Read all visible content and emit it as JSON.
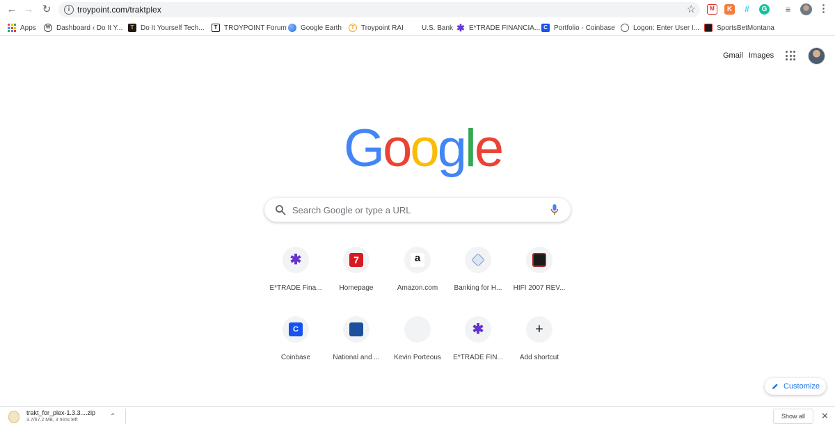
{
  "colors": {
    "google_blue": "#4285F4",
    "google_red": "#EA4335",
    "google_yellow": "#FBBC05",
    "google_green": "#34A853",
    "accent": "#1A73E8"
  },
  "toolbar": {
    "back_icon": "arrow-left-icon",
    "forward_icon": "arrow-right-icon",
    "reload_icon": "reload-icon",
    "url": "troypoint.com/traktplex",
    "bookmark_star_icon": "star-icon",
    "extensions": [
      "mail-extension-icon",
      "k-extension-icon",
      "slack-extension-icon",
      "grammarly-extension-icon",
      "playlist-icon"
    ]
  },
  "bookmarks": [
    {
      "label": "Apps",
      "icon": "apps-grid-icon"
    },
    {
      "label": "Dashboard ‹ Do It Y...",
      "icon": "wordpress-icon"
    },
    {
      "label": "Do It Yourself Tech...",
      "icon": "diy-icon"
    },
    {
      "label": "TROYPOINT Forum",
      "icon": "troypoint-icon"
    },
    {
      "label": "Google Earth",
      "icon": "google-earth-icon"
    },
    {
      "label": "Troypoint RAI",
      "icon": "troypoint-rai-icon"
    },
    {
      "label": "U.S. Bank",
      "icon": "bank-icon"
    },
    {
      "label": "E*TRADE FINANCIA...",
      "icon": "etrade-icon"
    },
    {
      "label": "Portfolio - Coinbase",
      "icon": "coinbase-icon"
    },
    {
      "label": "Logon: Enter User I...",
      "icon": "globe-icon"
    },
    {
      "label": "SportsBetMontana",
      "icon": "sportsbet-icon"
    }
  ],
  "header": {
    "gmail": "Gmail",
    "images": "Images"
  },
  "logo": {
    "letters": [
      "G",
      "o",
      "o",
      "g",
      "l",
      "e"
    ]
  },
  "search": {
    "placeholder": "Search Google or type a URL"
  },
  "shortcuts": [
    {
      "label": "E*TRADE Fina...",
      "icon": "etrade-icon"
    },
    {
      "label": "Homepage",
      "icon": "seven-icon"
    },
    {
      "label": "Amazon.com",
      "icon": "amazon-icon"
    },
    {
      "label": "Banking for H...",
      "icon": "bank-icon"
    },
    {
      "label": "HIFI 2007 REV...",
      "icon": "hifi-icon"
    },
    {
      "label": "Coinbase",
      "icon": "coinbase-icon"
    },
    {
      "label": "National and ...",
      "icon": "weather-channel-icon"
    },
    {
      "label": "Kevin Porteous",
      "icon": "blank-icon"
    },
    {
      "label": "E*TRADE FIN...",
      "icon": "etrade-icon"
    },
    {
      "label": "Add shortcut",
      "icon": "plus-icon"
    }
  ],
  "customize": {
    "label": "Customize"
  },
  "download": {
    "filename": "trakt_for_plex-1.3.3....zip",
    "info": "3.7/67.2 MB, 3 mins left",
    "show_all": "Show all"
  }
}
